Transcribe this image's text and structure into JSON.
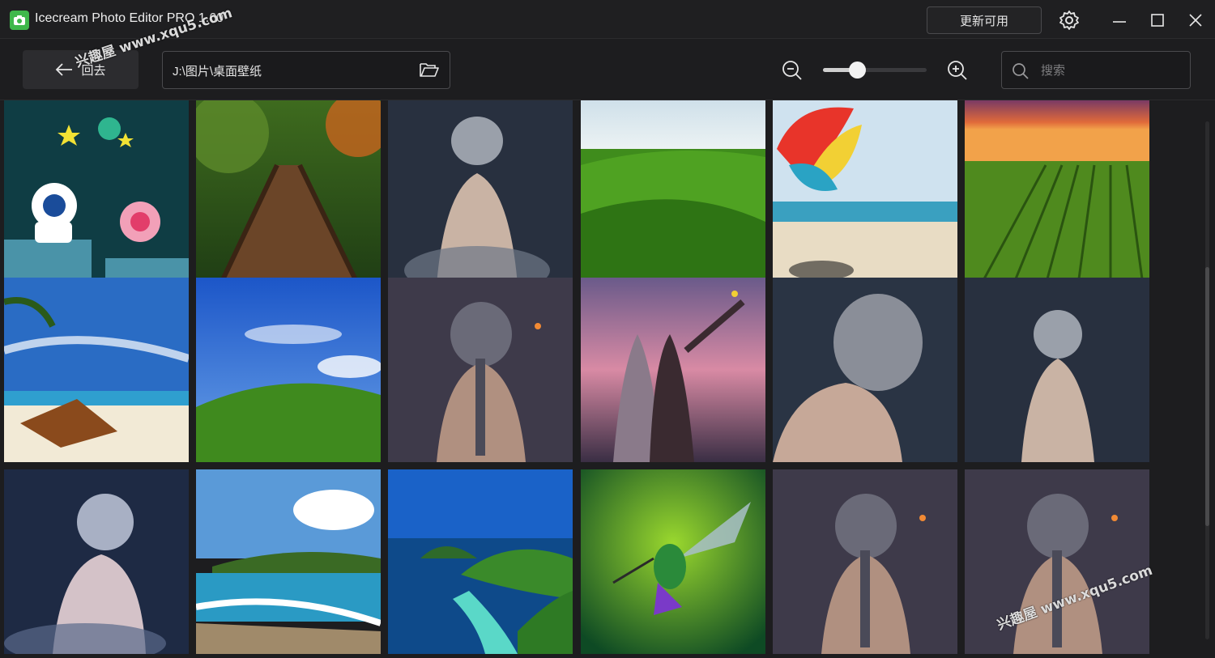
{
  "app": {
    "title": "Icecream Photo Editor PRO 1.60",
    "update_label": "更新可用",
    "accent": "#3fb84b"
  },
  "toolbar": {
    "back_label": "回去",
    "path": "J:\\图片\\桌面壁纸",
    "zoom_level": 0.33,
    "search_placeholder": "搜索"
  },
  "thumbnails": [
    {
      "subject": "cartoon-characters"
    },
    {
      "subject": "wooden-bridge-forest"
    },
    {
      "subject": "silver-haired-girl-back"
    },
    {
      "subject": "green-hills"
    },
    {
      "subject": "parasail-beach"
    },
    {
      "subject": "vineyard-sunset"
    },
    {
      "subject": "palm-beach-chairs"
    },
    {
      "subject": "bliss-hill"
    },
    {
      "subject": "braided-girl-dusk"
    },
    {
      "subject": "two-girls-sunset"
    },
    {
      "subject": "silver-haired-girl-closeup"
    },
    {
      "subject": "silver-haired-girl-back"
    },
    {
      "subject": "silver-haired-girl-back"
    },
    {
      "subject": "ocean-waves-island"
    },
    {
      "subject": "tropical-atoll"
    },
    {
      "subject": "hummingbird"
    },
    {
      "subject": "braided-girl-dusk"
    },
    {
      "subject": "braided-girl-dusk"
    }
  ],
  "watermarks": [
    "兴趣屋 www.xqu5.com",
    "兴趣屋 www.xqu5.com"
  ]
}
